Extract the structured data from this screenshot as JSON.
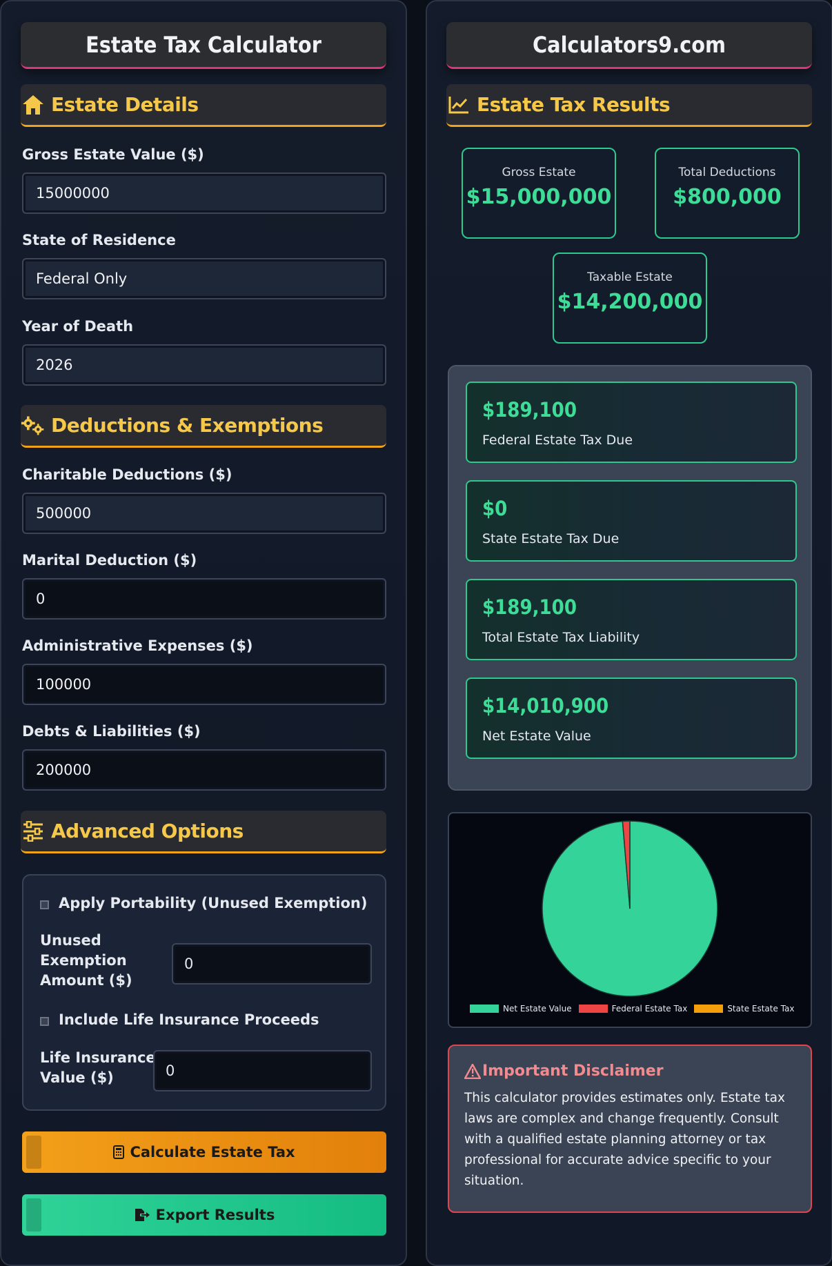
{
  "left": {
    "title": "Estate Tax Calculator",
    "estate_details": {
      "heading": "Estate Details",
      "gross_label": "Gross Estate Value ($)",
      "gross_value": "15000000",
      "state_label": "State of Residence",
      "state_value": "Federal Only",
      "year_label": "Year of Death",
      "year_value": "2026"
    },
    "deductions": {
      "heading": "Deductions & Exemptions",
      "charitable_label": "Charitable Deductions ($)",
      "charitable_value": "500000",
      "marital_label": "Marital Deduction ($)",
      "marital_value": "0",
      "admin_label": "Administrative Expenses ($)",
      "admin_value": "100000",
      "debts_label": "Debts & Liabilities ($)",
      "debts_value": "200000"
    },
    "advanced": {
      "heading": "Advanced Options",
      "portability_label": "Apply Portability (Unused Exemption)",
      "unused_label_1": "Unused",
      "unused_label_2": "Exemption",
      "unused_label_3": "Amount ($)",
      "unused_value": "0",
      "insurance_check_label": "Include Life Insurance Proceeds",
      "insurance_label_1": "Life Insurance",
      "insurance_label_2": "Value ($)",
      "insurance_value": "0"
    },
    "buttons": {
      "calculate": "Calculate Estate Tax",
      "export": "Export Results"
    }
  },
  "right": {
    "title": "Calculators9.com",
    "results_heading": "Estate Tax Results",
    "summary": [
      {
        "caption": "Gross Estate",
        "value": "$15,000,000"
      },
      {
        "caption": "Total Deductions",
        "value": "$800,000"
      },
      {
        "caption": "Taxable Estate",
        "value": "$14,200,000"
      }
    ],
    "results": [
      {
        "amount": "$189,100",
        "label": "Federal Estate Tax Due"
      },
      {
        "amount": "$0",
        "label": "State Estate Tax Due"
      },
      {
        "amount": "$189,100",
        "label": "Total Estate Tax Liability"
      },
      {
        "amount": "$14,010,900",
        "label": "Net Estate Value"
      }
    ],
    "disclaimer": {
      "heading": "Important Disclaimer",
      "body": "This calculator provides estimates only. Estate tax laws are complex and change frequently. Consult with a qualified estate planning attorney or tax professional for accurate advice specific to your situation."
    }
  },
  "chart_data": {
    "type": "pie",
    "categories": [
      "Net Estate Value",
      "Federal Estate Tax",
      "State Estate Tax"
    ],
    "values": [
      14010900,
      189100,
      0
    ],
    "colors": [
      "#34d399",
      "#ef4444",
      "#f59e0b"
    ],
    "legend": "bottom"
  },
  "colors": {
    "accent_green": "#3ddc97",
    "accent_gold": "#f6c84a",
    "accent_orange": "#f0a21b",
    "accent_pink": "#e0337a",
    "danger": "#e0464f"
  }
}
